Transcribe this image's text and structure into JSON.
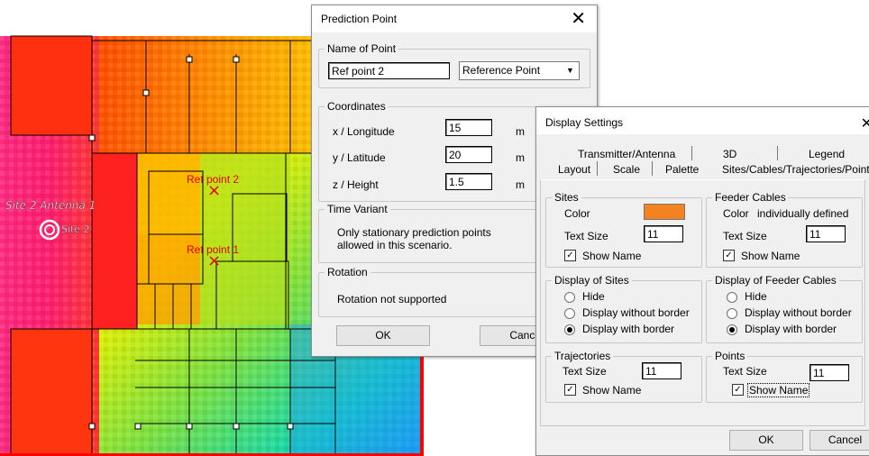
{
  "map": {
    "site_label": "Site 2 Antenna 1",
    "site_short": "Site 2",
    "ref_points": [
      {
        "label": "Ref point 2"
      },
      {
        "label": "Ref point 1"
      }
    ],
    "marker_glyph": "×"
  },
  "prediction_dialog": {
    "title": "Prediction Point",
    "close_glyph": "✕",
    "name_group": "Name of Point",
    "name_value": "Ref point 2",
    "type_value": "Reference Point",
    "coord_group": "Coordinates",
    "coords": [
      {
        "label": "x / Longitude",
        "value": "15",
        "unit": "m"
      },
      {
        "label": "y / Latitude",
        "value": "20",
        "unit": "m"
      },
      {
        "label": "z / Height",
        "value": "1.5",
        "unit": "m"
      }
    ],
    "time_group": "Time Variant",
    "time_text_1": "Only stationary prediction points",
    "time_text_2": "allowed in this scenario.",
    "rotation_group": "Rotation",
    "rotation_text": "Rotation not supported",
    "ok": "OK",
    "cancel": "Cancel"
  },
  "display_dialog": {
    "title": "Display Settings",
    "close_glyph": "✕",
    "tabs_row1": [
      "Transmitter/Antenna",
      "3D",
      "Legend"
    ],
    "tabs_row2": [
      "Layout",
      "Scale",
      "Palette",
      "Sites/Cables/Trajectories/Points"
    ],
    "sites": {
      "group": "Sites",
      "color_label": "Color",
      "color": "#f58220",
      "text_size_label": "Text Size",
      "text_size": "11",
      "show_name": "Show Name",
      "check_glyph": "✓"
    },
    "feeder": {
      "group": "Feeder Cables",
      "color_label": "Color",
      "color_value": "individually defined",
      "text_size_label": "Text Size",
      "text_size": "11",
      "show_name": "Show Name"
    },
    "display_sites": {
      "group": "Display of Sites",
      "options": [
        "Hide",
        "Display without border",
        "Display with border"
      ]
    },
    "display_feeder": {
      "group": "Display of Feeder Cables",
      "options": [
        "Hide",
        "Display without border",
        "Display with border"
      ]
    },
    "trajectories": {
      "group": "Trajectories",
      "text_size_label": "Text Size",
      "text_size": "11",
      "show_name": "Show Name"
    },
    "points": {
      "group": "Points",
      "text_size_label": "Text Size",
      "text_size": "11",
      "show_name": "Show Name"
    },
    "ok": "OK",
    "cancel": "Cancel"
  }
}
